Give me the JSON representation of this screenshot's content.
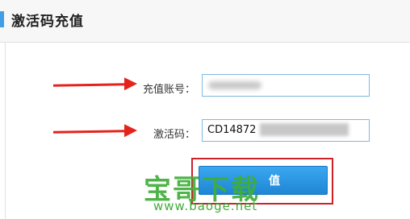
{
  "header": {
    "title": "激活码充值",
    "accent_color": "#3f9ee6"
  },
  "form": {
    "account": {
      "label": "充值账号：",
      "value": ""
    },
    "code": {
      "label": "激活码：",
      "value": "CD14872"
    },
    "submit_label": "值"
  },
  "watermark": {
    "main": "宝哥下载",
    "url": "www.baoge.net"
  },
  "colors": {
    "arrow": "#e5231d",
    "button": "#2a97e3",
    "highlight_border": "#d0202a",
    "watermark": "#3fae3a"
  }
}
